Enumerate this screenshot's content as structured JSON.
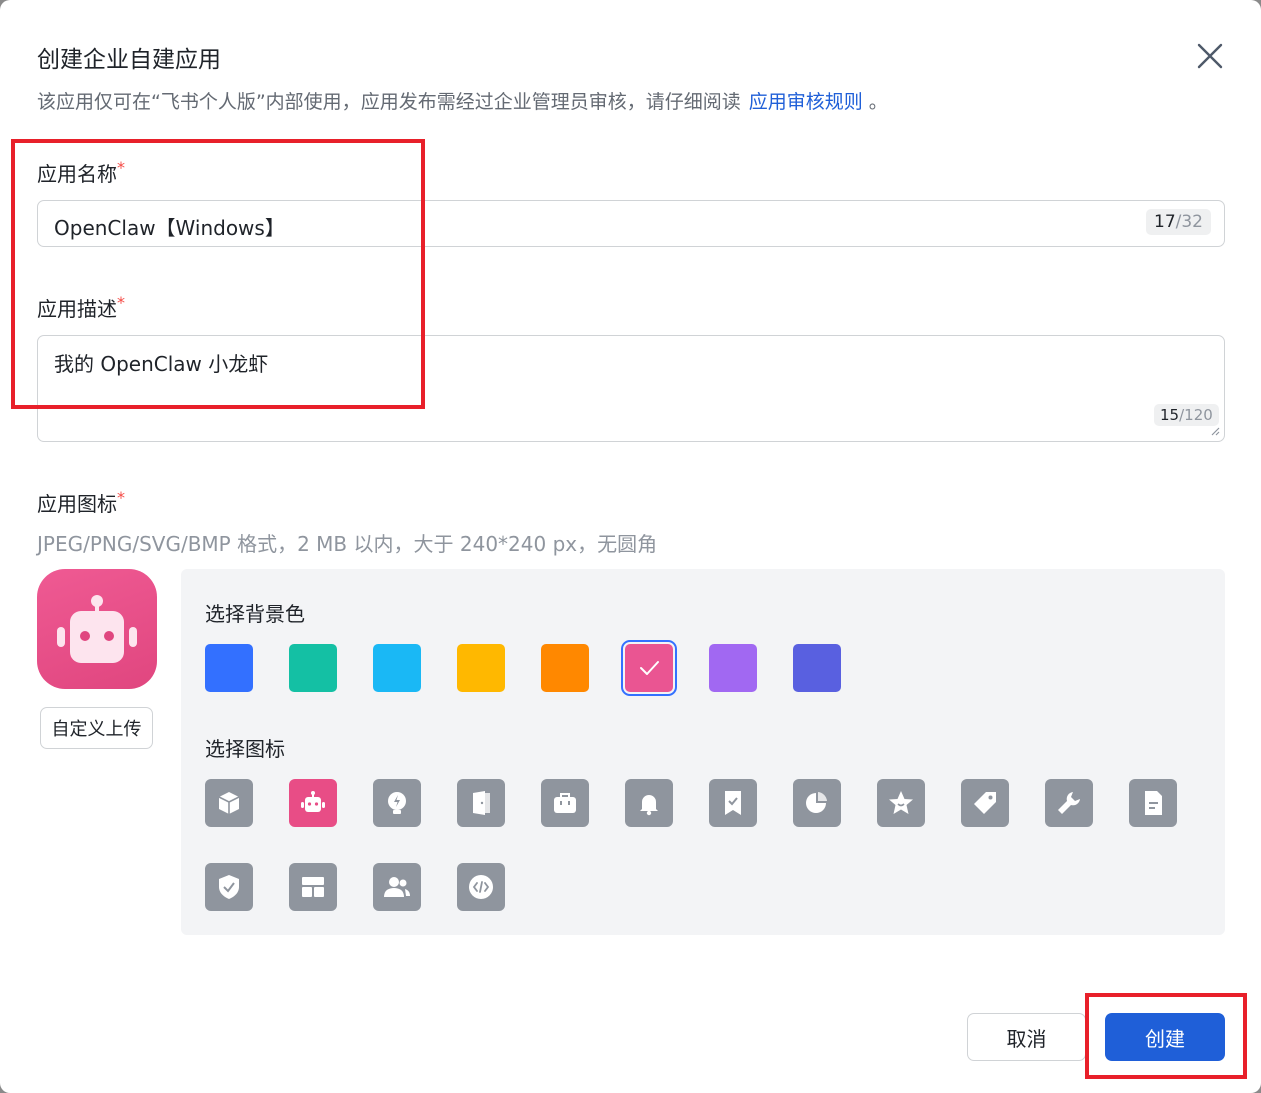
{
  "dialog": {
    "title": "创建企业自建应用",
    "subtitle": "该应用仅可在“飞书个人版”内部使用，应用发布需经过企业管理员审核，请仔细阅读",
    "rules_link": "应用审核规则",
    "subtitle_end": "。"
  },
  "name_field": {
    "label": "应用名称",
    "required": "*",
    "value": "OpenClaw【Windows】",
    "count": "17",
    "max": "/32"
  },
  "desc_field": {
    "label": "应用描述",
    "required": "*",
    "value": "我的 OpenClaw 小龙虾",
    "count": "15",
    "max": "/120"
  },
  "icon_field": {
    "label": "应用图标",
    "required": "*",
    "hint": "JPEG/PNG/SVG/BMP 格式，2 MB 以内，大于 240*240 px，无圆角",
    "upload_label": "自定义上传"
  },
  "picker": {
    "bg_title": "选择背景色",
    "icon_title": "选择图标",
    "colors": [
      "#3370ff",
      "#14c0a4",
      "#1ab8f5",
      "#ffb800",
      "#ff8800",
      "#ea5592",
      "#a168f2",
      "#5960e0"
    ],
    "selected_color_index": 5,
    "icons": [
      "box-icon",
      "robot-icon",
      "lightbulb-icon",
      "door-icon",
      "briefcase-icon",
      "bell-icon",
      "bookmark-check-icon",
      "pie-chart-icon",
      "star-icon",
      "tag-icon",
      "wrench-icon",
      "document-icon",
      "shield-check-icon",
      "layout-icon",
      "users-icon",
      "code-icon"
    ],
    "selected_icon": "robot-icon"
  },
  "footer": {
    "cancel_label": "取消",
    "create_label": "创建"
  }
}
